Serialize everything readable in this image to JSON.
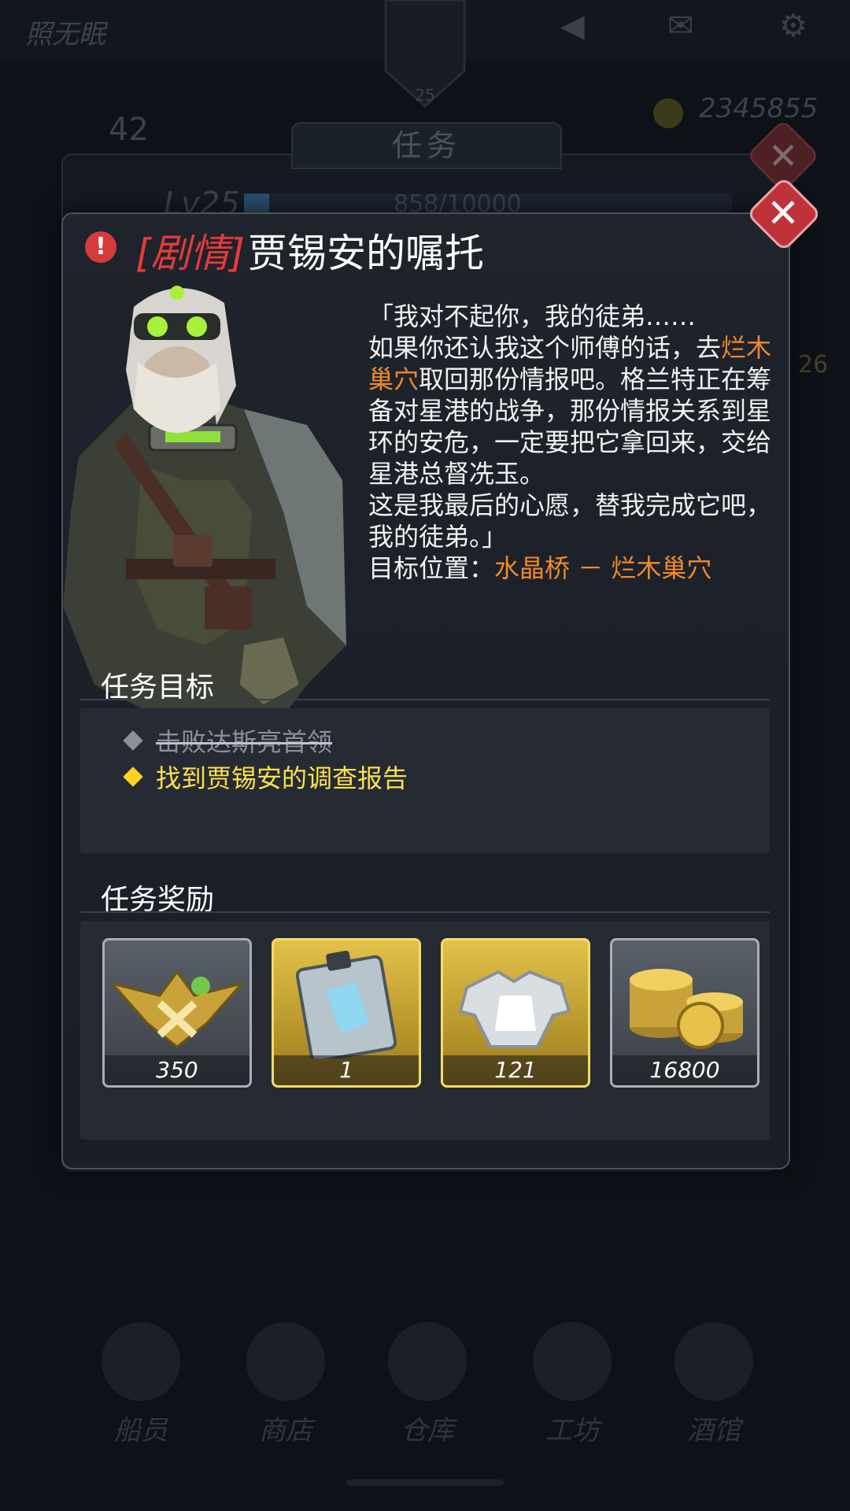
{
  "background": {
    "player_name": "照无眠",
    "level_badge": "25",
    "currency": "2345855",
    "stat_value": "42",
    "panel_tab": "任务",
    "level": "Lv25",
    "xp": "858/10000",
    "side_badge": "26",
    "nav": [
      "船员",
      "商店",
      "仓库",
      "工坊",
      "酒馆"
    ]
  },
  "modal": {
    "tag": "[剧情]",
    "title": "贾锡安的嘱托",
    "story": {
      "line1": "「我对不起你，我的徒弟……",
      "para2_a": "如果你还认我这个师傅的话，去",
      "para2_place": "烂木巢穴",
      "para2_b": "取回那份情报吧。格兰特正在筹备对星港的战争，那份情报关系到星环的安危，一定要把它拿回来，交给星港总督冼玉。",
      "para3": "这是我最后的心愿，替我完成它吧，我的徒弟。」",
      "location_label": "目标位置：",
      "location_value": "水晶桥 － 烂木巢穴"
    },
    "objectives_title": "任务目标",
    "objectives": [
      {
        "text": "击败达斯亮首领",
        "done": true
      },
      {
        "text": "找到贾锡安的调查报告",
        "done": false
      }
    ],
    "rewards_title": "任务奖励",
    "rewards": [
      {
        "icon": "rank-badge-icon",
        "count": "350",
        "rarity": "gray"
      },
      {
        "icon": "blueprint-clipboard-icon",
        "count": "1",
        "rarity": "gold"
      },
      {
        "icon": "armor-fragment-icon",
        "count": "121",
        "rarity": "gold"
      },
      {
        "icon": "gold-coins-icon",
        "count": "16800",
        "rarity": "gray"
      }
    ]
  },
  "colors": {
    "accent_orange": "#f08a2a",
    "tag_red": "#e23b3b",
    "objective_active": "#ffe04a",
    "close_red": "#c0323a"
  }
}
